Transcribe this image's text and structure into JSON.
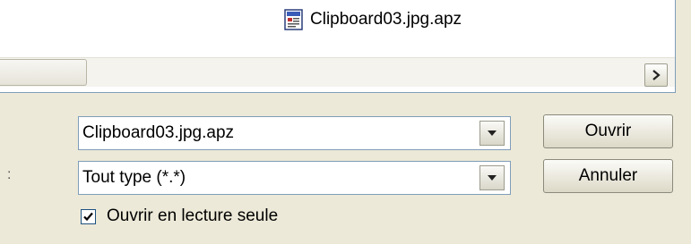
{
  "file_list": {
    "items": [
      {
        "name": "Clipboard03.jpg.apz",
        "icon": "apz-file-icon"
      }
    ]
  },
  "file_name_field": {
    "value": "Clipboard03.jpg.apz"
  },
  "file_type_field": {
    "value": "Tout type (*.*)"
  },
  "buttons": {
    "open_label": "Ouvrir",
    "cancel_label": "Annuler"
  },
  "readonly_checkbox": {
    "label": "Ouvrir en lecture seule",
    "checked": true
  },
  "labels": {
    "type_colon": ":"
  },
  "colors": {
    "dialog_bg": "#ece9d8",
    "field_border": "#7f9db9",
    "checkbox_border": "#1c5180"
  }
}
